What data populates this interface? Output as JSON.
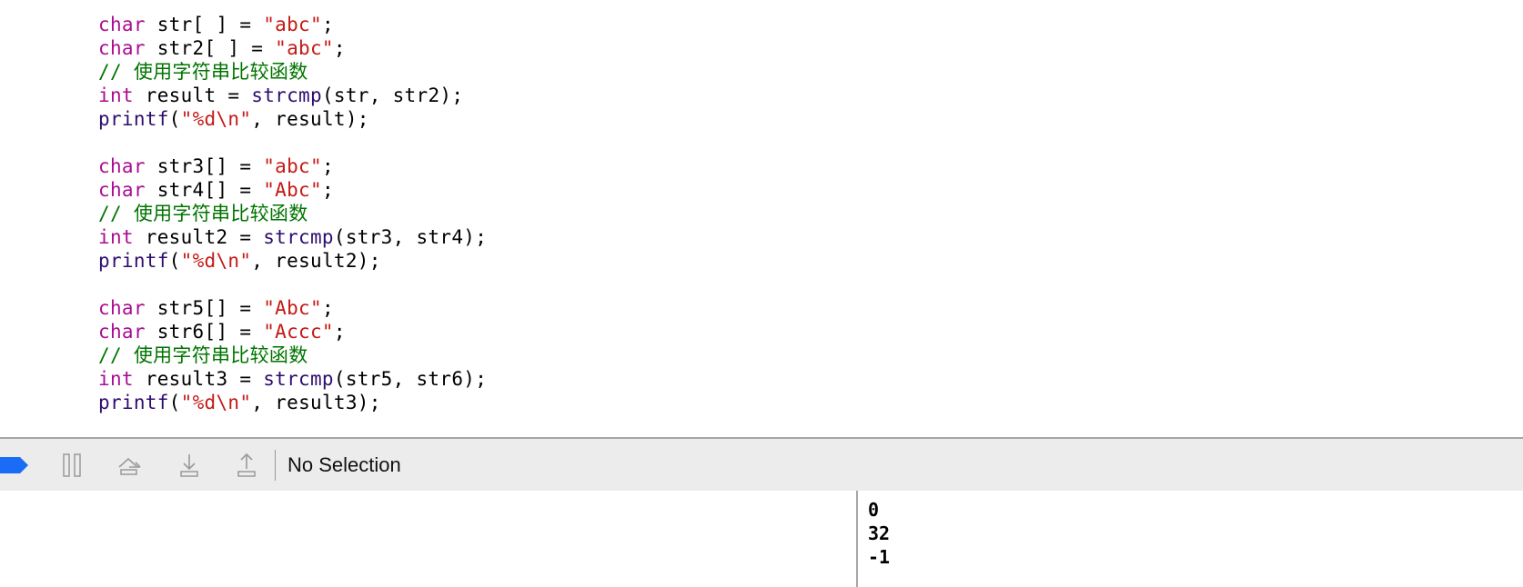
{
  "editor": {
    "lines": [
      [
        {
          "t": "char",
          "c": "kw"
        },
        {
          "t": " str[ ] = ",
          "c": ""
        },
        {
          "t": "\"abc\"",
          "c": "str"
        },
        {
          "t": ";",
          "c": ""
        }
      ],
      [
        {
          "t": "char",
          "c": "kw"
        },
        {
          "t": " str2[ ] = ",
          "c": ""
        },
        {
          "t": "\"abc\"",
          "c": "str"
        },
        {
          "t": ";",
          "c": ""
        }
      ],
      [
        {
          "t": "// 使用字符串比较函数",
          "c": "cm"
        }
      ],
      [
        {
          "t": "int",
          "c": "kw"
        },
        {
          "t": " result = ",
          "c": ""
        },
        {
          "t": "strcmp",
          "c": "fn"
        },
        {
          "t": "(str, str2);",
          "c": ""
        }
      ],
      [
        {
          "t": "printf",
          "c": "fn"
        },
        {
          "t": "(",
          "c": ""
        },
        {
          "t": "\"%d\\n\"",
          "c": "str"
        },
        {
          "t": ", result);",
          "c": ""
        }
      ],
      [],
      [
        {
          "t": "char",
          "c": "kw"
        },
        {
          "t": " str3[] = ",
          "c": ""
        },
        {
          "t": "\"abc\"",
          "c": "str"
        },
        {
          "t": ";",
          "c": ""
        }
      ],
      [
        {
          "t": "char",
          "c": "kw"
        },
        {
          "t": " str4[] = ",
          "c": ""
        },
        {
          "t": "\"Abc\"",
          "c": "str"
        },
        {
          "t": ";",
          "c": ""
        }
      ],
      [
        {
          "t": "// 使用字符串比较函数",
          "c": "cm"
        }
      ],
      [
        {
          "t": "int",
          "c": "kw"
        },
        {
          "t": " result2 = ",
          "c": ""
        },
        {
          "t": "strcmp",
          "c": "fn"
        },
        {
          "t": "(str3, str4);",
          "c": ""
        }
      ],
      [
        {
          "t": "printf",
          "c": "fn"
        },
        {
          "t": "(",
          "c": ""
        },
        {
          "t": "\"%d\\n\"",
          "c": "str"
        },
        {
          "t": ", result2);",
          "c": ""
        }
      ],
      [],
      [
        {
          "t": "char",
          "c": "kw"
        },
        {
          "t": " str5[] = ",
          "c": ""
        },
        {
          "t": "\"Abc\"",
          "c": "str"
        },
        {
          "t": ";",
          "c": ""
        }
      ],
      [
        {
          "t": "char",
          "c": "kw"
        },
        {
          "t": " str6[] = ",
          "c": ""
        },
        {
          "t": "\"Accc\"",
          "c": "str"
        },
        {
          "t": ";",
          "c": ""
        }
      ],
      [
        {
          "t": "// 使用字符串比较函数",
          "c": "cm"
        }
      ],
      [
        {
          "t": "int",
          "c": "kw"
        },
        {
          "t": " result3 = ",
          "c": ""
        },
        {
          "t": "strcmp",
          "c": "fn"
        },
        {
          "t": "(str5, str6);",
          "c": ""
        }
      ],
      [
        {
          "t": "printf",
          "c": "fn"
        },
        {
          "t": "(",
          "c": ""
        },
        {
          "t": "\"%d\\n\"",
          "c": "str"
        },
        {
          "t": ", result3);",
          "c": ""
        }
      ]
    ]
  },
  "debug_toolbar": {
    "icons": [
      {
        "name": "breakpoints-toggle-icon",
        "color": "#1a6bf5"
      },
      {
        "name": "pause-icon"
      },
      {
        "name": "step-over-icon"
      },
      {
        "name": "step-into-icon"
      },
      {
        "name": "step-out-icon"
      }
    ],
    "selection_label": "No Selection"
  },
  "console": {
    "output_lines": [
      "0",
      "32",
      "-1"
    ]
  },
  "colors": {
    "keyword": "#aa0d91",
    "function": "#2e0d6e",
    "string": "#c41a16",
    "comment": "#007400",
    "accent": "#1a6bf5"
  }
}
